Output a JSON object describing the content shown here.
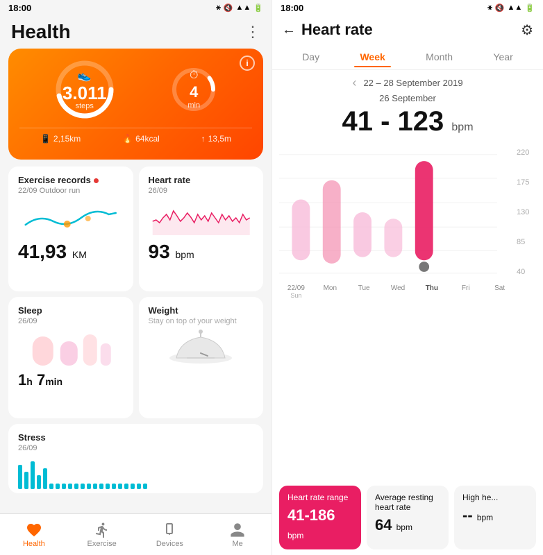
{
  "left": {
    "statusBar": {
      "time": "18:00"
    },
    "appTitle": "Health",
    "menuIcon": "⋮",
    "activityCard": {
      "infoIcon": "i",
      "steps": {
        "value": "3.011",
        "label": "steps",
        "icon": "👟",
        "progress": 0.65
      },
      "activeTime": {
        "value": "4",
        "label": "min",
        "icon": "⏱",
        "progress": 0.15
      },
      "stats": [
        {
          "icon": "📱",
          "value": "2,15km"
        },
        {
          "icon": "🔥",
          "value": "64kcal"
        },
        {
          "icon": "↑",
          "value": "13,5m"
        }
      ]
    },
    "cards": {
      "exercise": {
        "title": "Exercise records",
        "hasDot": true,
        "date": "22/09 Outdoor run",
        "value": "41,93",
        "unit": "KM"
      },
      "heartRate": {
        "title": "Heart rate",
        "date": "26/09",
        "value": "93",
        "unit": "bpm"
      },
      "sleep": {
        "title": "Sleep",
        "date": "26/09",
        "value": "1",
        "valueH": "h",
        "value2": "7",
        "value2Unit": "min"
      },
      "weight": {
        "title": "Weight",
        "subtitle": "Stay on top of your weight"
      },
      "stress": {
        "title": "Stress",
        "date": "26/09"
      }
    },
    "nav": [
      {
        "label": "Health",
        "icon": "❤",
        "active": true
      },
      {
        "label": "Exercise",
        "icon": "🏃",
        "active": false
      },
      {
        "label": "Devices",
        "icon": "⌚",
        "active": false
      },
      {
        "label": "Me",
        "icon": "👤",
        "active": false
      }
    ]
  },
  "right": {
    "statusBar": {
      "time": "18:00"
    },
    "title": "Heart rate",
    "tabs": [
      {
        "label": "Day",
        "active": false
      },
      {
        "label": "Week",
        "active": true
      },
      {
        "label": "Month",
        "active": false
      },
      {
        "label": "Year",
        "active": false
      }
    ],
    "dateRange": "22 – 28 September 2019",
    "dateSelected": "26 September",
    "bpmRange": "41 - 123",
    "bpmUnit": "bpm",
    "chart": {
      "yLabels": [
        "220",
        "175",
        "130",
        "85",
        "40"
      ],
      "days": [
        {
          "label": "22/09",
          "sublabel": "Sun",
          "active": false,
          "minBar": 30,
          "maxBar": 130
        },
        {
          "label": "Mon",
          "sublabel": "",
          "active": false,
          "minBar": 25,
          "maxBar": 160
        },
        {
          "label": "Tue",
          "sublabel": "",
          "active": false,
          "minBar": 20,
          "maxBar": 90
        },
        {
          "label": "Wed",
          "sublabel": "",
          "active": false,
          "minBar": 15,
          "maxBar": 80
        },
        {
          "label": "Thu",
          "sublabel": "",
          "active": true,
          "minBar": 20,
          "maxBar": 175
        },
        {
          "label": "Fri",
          "sublabel": "",
          "active": false,
          "minBar": 0,
          "maxBar": 0
        },
        {
          "label": "Sat",
          "sublabel": "",
          "active": false,
          "minBar": 0,
          "maxBar": 0
        }
      ]
    },
    "statsCards": [
      {
        "title": "Heart rate range",
        "value": "41-186",
        "unit": "bpm",
        "highlighted": true
      },
      {
        "title": "Average resting heart rate",
        "value": "64",
        "unit": "bpm",
        "highlighted": false
      },
      {
        "title": "High he...",
        "value": "--",
        "unit": "bpm",
        "highlighted": false
      }
    ]
  }
}
